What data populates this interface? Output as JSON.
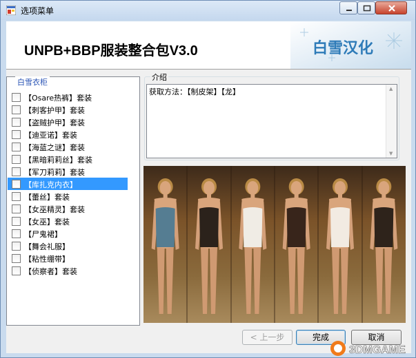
{
  "window": {
    "title": "选项菜单"
  },
  "header": {
    "app_title": "UNPB+BBP服装整合包V3.0",
    "logo_text": "白雪汉化"
  },
  "wardrobe": {
    "legend": "白雪衣柜",
    "items": [
      {
        "label": "【Osare热裤】套装",
        "checked": false,
        "selected": false
      },
      {
        "label": "【刺客护甲】套装",
        "checked": false,
        "selected": false
      },
      {
        "label": "【盗贼护甲】套装",
        "checked": false,
        "selected": false
      },
      {
        "label": "【迪亚诺】套装",
        "checked": false,
        "selected": false
      },
      {
        "label": "【海蓝之谜】套装",
        "checked": false,
        "selected": false
      },
      {
        "label": "【黑暗莉莉丝】套装",
        "checked": false,
        "selected": false
      },
      {
        "label": "【军刀莉莉】套装",
        "checked": false,
        "selected": false
      },
      {
        "label": "【库扎克内衣】",
        "checked": false,
        "selected": true
      },
      {
        "label": "【蕾丝】套装",
        "checked": false,
        "selected": false
      },
      {
        "label": "【女巫精灵】套装",
        "checked": false,
        "selected": false
      },
      {
        "label": "【女巫】套装",
        "checked": false,
        "selected": false
      },
      {
        "label": "【尸鬼裙】",
        "checked": false,
        "selected": false
      },
      {
        "label": "【舞会礼服】",
        "checked": false,
        "selected": false
      },
      {
        "label": "【粘性绷带】",
        "checked": false,
        "selected": false
      },
      {
        "label": "【侦察者】套装",
        "checked": false,
        "selected": false
      }
    ]
  },
  "intro": {
    "legend": "介绍",
    "text": "获取方法：【制皮架】【龙】"
  },
  "preview": {
    "figure_colors": [
      "#4a7a94",
      "#1c1712",
      "#f2f2ee",
      "#2a1a12",
      "#f4f1ea",
      "#1f1812"
    ]
  },
  "buttons": {
    "prev": "< 上一步",
    "finish": "完成",
    "cancel": "取消"
  },
  "watermark": {
    "text": "3DMGAME"
  },
  "colors": {
    "selection": "#3399ff",
    "legend_blue": "#2a54b5",
    "titlebar": "#c9dbee",
    "close_button": "#c7432d"
  }
}
